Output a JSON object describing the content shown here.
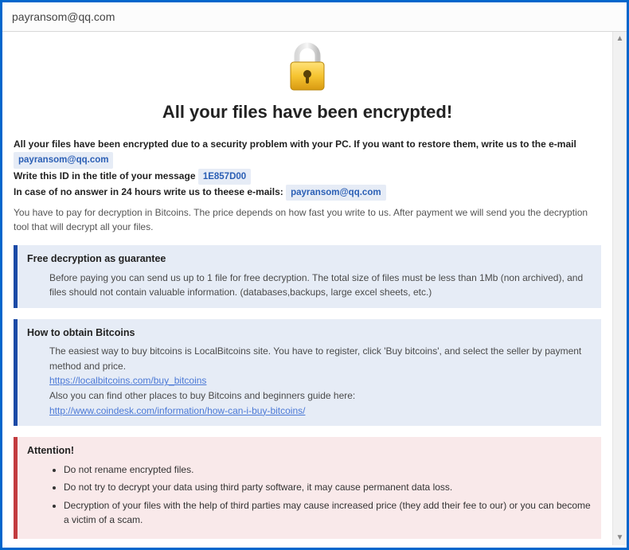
{
  "window": {
    "title": "payransom@qq.com"
  },
  "headline": "All your files have been encrypted!",
  "intro": {
    "line1_a": "All your files have been encrypted due to a security problem with your PC. If you want to restore them, write us to the e-mail ",
    "email1": "payransom@qq.com",
    "line2_a": "Write this ID in the title of your message ",
    "id_code": "1E857D00",
    "line3_a": "In case of no answer in 24 hours write us to theese e-mails: ",
    "email2": "payransom@qq.com"
  },
  "payline": "You have to pay for decryption in Bitcoins. The price depends on how fast you write to us. After payment we will send you the decryption tool that will decrypt all your files.",
  "guarantee": {
    "title": "Free decryption as guarantee",
    "body": "Before paying you can send us up to 1 file for free decryption. The total size of files must be less than 1Mb (non archived), and files should not contain valuable information. (databases,backups, large excel sheets, etc.)"
  },
  "obtain": {
    "title": "How to obtain Bitcoins",
    "line1": "The easiest way to buy bitcoins is LocalBitcoins site. You have to register, click 'Buy bitcoins', and select the seller by payment method and price.",
    "link1": "https://localbitcoins.com/buy_bitcoins",
    "line2": "Also you can find other places to buy Bitcoins and beginners guide here:",
    "link2": "http://www.coindesk.com/information/how-can-i-buy-bitcoins/"
  },
  "attention": {
    "title": "Attention!",
    "items": [
      "Do not rename encrypted files.",
      "Do not try to decrypt your data using third party software, it may cause permanent data loss.",
      "Decryption of your files with the help of third parties may cause increased price (they add their fee to our) or you can become a victim of a scam."
    ]
  }
}
